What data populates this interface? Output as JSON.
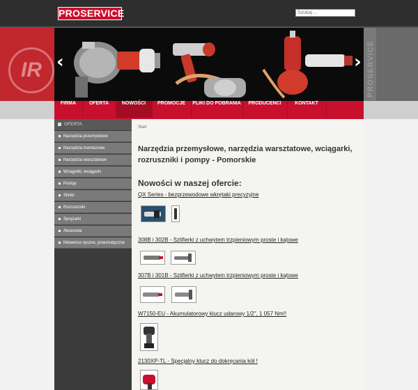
{
  "header": {
    "logo": "PROSERVICE",
    "search_placeholder": "Szukaj ..."
  },
  "banner": {
    "left_logo": "IR",
    "vertical_brand": "PROSERVICE",
    "prev_arrow": "‹",
    "next_arrow": "›"
  },
  "nav": {
    "items": [
      {
        "label": "FIRMA"
      },
      {
        "label": "OFERTA"
      },
      {
        "label": "NOWOŚCI"
      },
      {
        "label": "PROMOCJE"
      },
      {
        "label": "PLIKI DO POBRANIA"
      },
      {
        "label": "PRODUCENCI"
      },
      {
        "label": "KONTAKT"
      }
    ],
    "active_index": 2
  },
  "sidebar": {
    "heading": "OFERTA",
    "items": [
      {
        "label": "Narzędzia przemysłowe"
      },
      {
        "label": "Narzędzia montażowe"
      },
      {
        "label": "Narzędzia warsztatowe"
      },
      {
        "label": "Wciągniki, wciągarki"
      },
      {
        "label": "Pompy"
      },
      {
        "label": "Silniki"
      },
      {
        "label": "Rozruszniki"
      },
      {
        "label": "Sprężarki"
      },
      {
        "label": "Akcesoria"
      },
      {
        "label": "Nitownice ręczne, pneumatyczne"
      }
    ]
  },
  "content": {
    "breadcrumb": "Start",
    "title": "Narzędzia przemysłowe, narzędzia warsztatowe, wciągarki, rozruszniki i pompy - Pomorskie",
    "news_heading": "Nowości w naszej ofercie:",
    "products": [
      {
        "name": "QX Series - bezprzewodowe wkrętaki precyzyjne"
      },
      {
        "name": "308B i 302B - Szlifierki z uchwytem trzpieniowym proste i kątowe"
      },
      {
        "name": "307B i 301B - Szlifierki z uchwytem trzpieniowym proste i kątowe"
      },
      {
        "name": "W7150-EU - Akumulatorowy klucz udarowy 1/2\", 1 057 Nm!!"
      },
      {
        "name": "2130XP-TL - Specjalny klucz do dokręcania kół !"
      }
    ]
  },
  "colors": {
    "brand_red": "#c8102e",
    "dark_bg": "#2e2e2e",
    "sidebar_item": "#7a7a7a"
  }
}
